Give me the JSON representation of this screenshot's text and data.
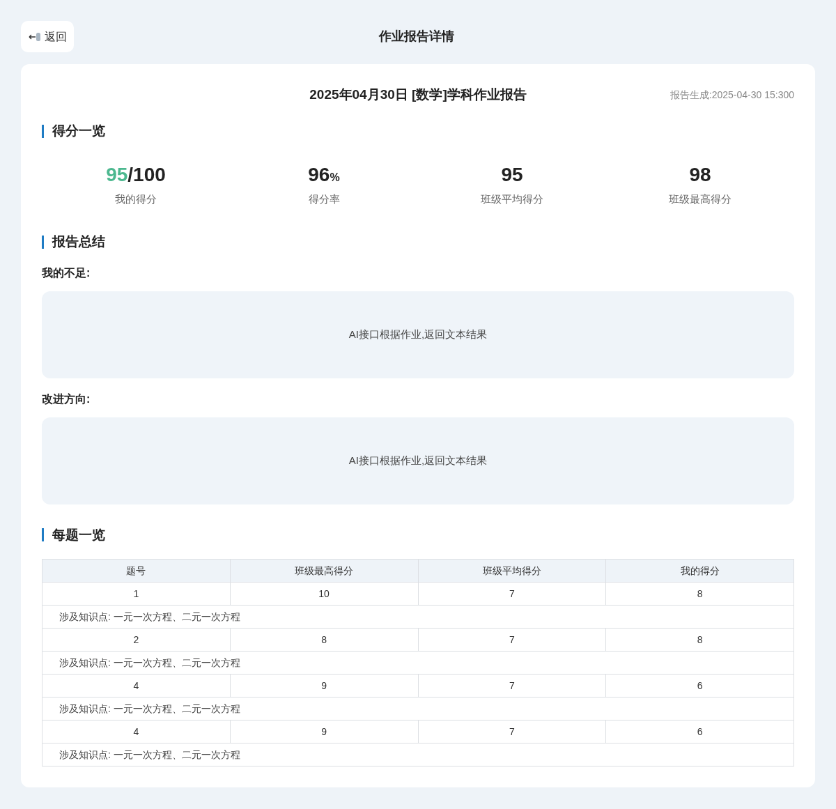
{
  "back_button": {
    "label": "返回"
  },
  "page_title": "作业报告详情",
  "report": {
    "title": "2025年04月30日 [数学]学科作业报告",
    "generated": "报告生成:2025-04-30 15:300"
  },
  "score_section": {
    "title": "得分一览",
    "stats": [
      {
        "parts": [
          {
            "text": "95",
            "kind": "accent"
          },
          {
            "text": "/100",
            "kind": "main"
          }
        ],
        "label": "我的得分"
      },
      {
        "parts": [
          {
            "text": "96",
            "kind": "main"
          },
          {
            "text": "%",
            "kind": "unit"
          }
        ],
        "label": "得分率"
      },
      {
        "parts": [
          {
            "text": "95",
            "kind": "main"
          }
        ],
        "label": "班级平均得分"
      },
      {
        "parts": [
          {
            "text": "98",
            "kind": "main"
          }
        ],
        "label": "班级最高得分"
      }
    ]
  },
  "summary_section": {
    "title": "报告总结",
    "blocks": [
      {
        "heading": "我的不足:",
        "text": "AI接口根据作业,返回文本结果"
      },
      {
        "heading": "改进方向:",
        "text": "AI接口根据作业,返回文本结果"
      }
    ]
  },
  "question_section": {
    "title": "每题一览",
    "table": {
      "columns": [
        "题号",
        "班级最高得分",
        "班级平均得分",
        "我的得分"
      ],
      "rows": [
        {
          "cells": [
            "1",
            "10",
            "7",
            "8"
          ],
          "note": "涉及知识点: 一元一次方程、二元一次方程"
        },
        {
          "cells": [
            "2",
            "8",
            "7",
            "8"
          ],
          "note": "涉及知识点: 一元一次方程、二元一次方程"
        },
        {
          "cells": [
            "4",
            "9",
            "7",
            "6"
          ],
          "note": "涉及知识点: 一元一次方程、二元一次方程"
        },
        {
          "cells": [
            "4",
            "9",
            "7",
            "6"
          ],
          "note": "涉及知识点: 一元一次方程、二元一次方程"
        }
      ]
    }
  }
}
